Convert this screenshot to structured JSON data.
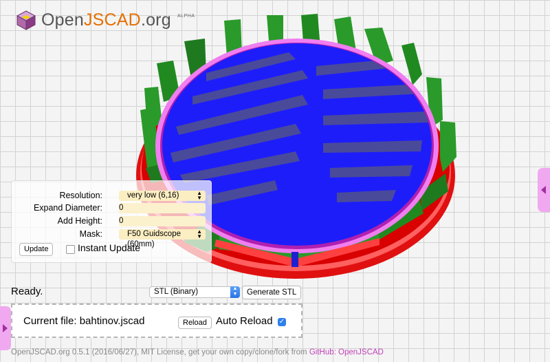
{
  "brand": {
    "name_part1": "Open",
    "name_part2": "JSCAD",
    "name_part3": ".org",
    "badge": "ALPHA",
    "accent_color": "#e66f00"
  },
  "parameters": {
    "resolution": {
      "label": "Resolution:",
      "value": "very low (6,16)"
    },
    "expand_diameter": {
      "label": "Expand Diameter:",
      "value": "0"
    },
    "add_height": {
      "label": "Add Height:",
      "value": "0"
    },
    "mask": {
      "label": "Mask:",
      "value": "F50 Guidscope (60mm)"
    },
    "update_button": "Update",
    "instant_update": {
      "label": "Instant Update",
      "checked": false
    }
  },
  "status": {
    "text": "Ready.",
    "format_select": "STL (Binary)",
    "generate_button": "Generate STL"
  },
  "file": {
    "label": "Current file: bahtinov.jscad",
    "reload_button": "Reload",
    "auto_reload_label": "Auto Reload",
    "auto_reload_checked": true
  },
  "footer": {
    "text": "OpenJSCAD.org 0.5.1 (2016/06/27), MIT License, get your own copy/clone/fork from",
    "link": "GitHub: OpenJSCAD",
    "link_color": "#c040b8"
  },
  "model": {
    "colors": {
      "wall": "#1e7d1e",
      "grid": "#1a1aff",
      "rim": "#ff2020",
      "highlight": "#f07ef0"
    }
  },
  "icons": [
    "logo-cube-icon",
    "chevron-updown-icon",
    "checkmark-icon",
    "panel-toggle-right-icon",
    "panel-toggle-left-icon"
  ]
}
